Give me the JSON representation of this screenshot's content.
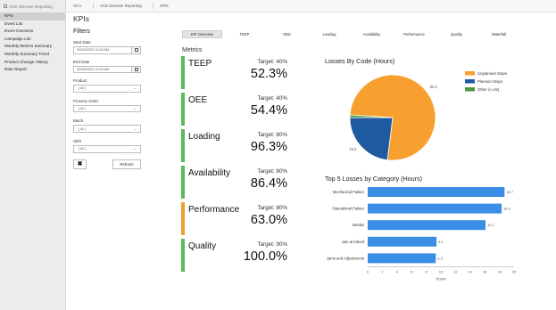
{
  "app": {
    "name": "ACE Discrete Reporting",
    "breadcrumbs": [
      "OCV",
      "ACE Discrete Reporting",
      "KPIs"
    ]
  },
  "sidebar": {
    "items": [
      {
        "label": "KPIs",
        "active": true
      },
      {
        "label": "Event List",
        "active": false
      },
      {
        "label": "Event Overview",
        "active": false
      },
      {
        "label": "Campaign List",
        "active": false
      },
      {
        "label": "Monthly Metrics Summary",
        "active": false
      },
      {
        "label": "Monthly Summary Trend",
        "active": false
      },
      {
        "label": "Product Change History",
        "active": false
      },
      {
        "label": "Rate Report",
        "active": false
      }
    ]
  },
  "page": {
    "title": "KPIs"
  },
  "filters": {
    "title": "Filters",
    "start_date": {
      "label": "Start Date",
      "value": "02/01/2022 12:00 AM"
    },
    "end_date": {
      "label": "End Date",
      "value": "02/26/2022 12:00 AM"
    },
    "product": {
      "label": "Product",
      "value": "[ All ]"
    },
    "process_order": {
      "label": "Process Order",
      "value": "[ All ]"
    },
    "batch": {
      "label": "Batch",
      "value": "[ All ]"
    },
    "shift": {
      "label": "Shift",
      "value": "[ All ]"
    },
    "clear_label": "✖",
    "refresh_label": "Refresh"
  },
  "tabs": [
    "KPI Overview",
    "TEEP",
    "OEE",
    "Loading",
    "Availability",
    "Performance",
    "Quality",
    "Waterfall"
  ],
  "metrics": {
    "title": "Metrics",
    "items": [
      {
        "name": "TEEP",
        "target": "Target: 40%",
        "value": "52.3%",
        "color": "#5cb85c"
      },
      {
        "name": "OEE",
        "target": "Target: 40%",
        "value": "54.4%",
        "color": "#5cb85c"
      },
      {
        "name": "Loading",
        "target": "Target: 80%",
        "value": "96.3%",
        "color": "#5cb85c"
      },
      {
        "name": "Availability",
        "target": "Target: 80%",
        "value": "86.4%",
        "color": "#5cb85c"
      },
      {
        "name": "Performance",
        "target": "Target: 80%",
        "value": "63.0%",
        "color": "#f0a030"
      },
      {
        "name": "Quality",
        "target": "Target: 90%",
        "value": "100.0%",
        "color": "#5cb85c"
      }
    ]
  },
  "chart_data": [
    {
      "type": "pie",
      "title": "Losses By Code (Hours)",
      "legend_position": "top-right",
      "slices": [
        {
          "label": "Unplanned Stops",
          "value": 63.3,
          "color": "#f7a030"
        },
        {
          "label": "Planned Stops",
          "value": 19.2,
          "color": "#1d5aa0"
        },
        {
          "label": "Other (<=0s)",
          "value": 0.8,
          "color": "#4a9a3c"
        }
      ],
      "data_labels": [
        "19.2",
        "63.3"
      ]
    },
    {
      "type": "bar",
      "orientation": "horizontal",
      "title": "Top 5 Losses by Category (Hours)",
      "categories": [
        "Mechanical Failure",
        "Operational Failure",
        "Breaks",
        "Jam at Infeed",
        "Jams and Adjustments"
      ],
      "values": [
        18.7,
        18.3,
        16.1,
        9.4,
        9.3
      ],
      "xlabel": "Hours",
      "xlim": [
        0,
        20
      ],
      "xticks": [
        0,
        2,
        4,
        6,
        8,
        10,
        12,
        14,
        16,
        18,
        20
      ],
      "grid": false,
      "color": "#3a8ee6"
    }
  ]
}
